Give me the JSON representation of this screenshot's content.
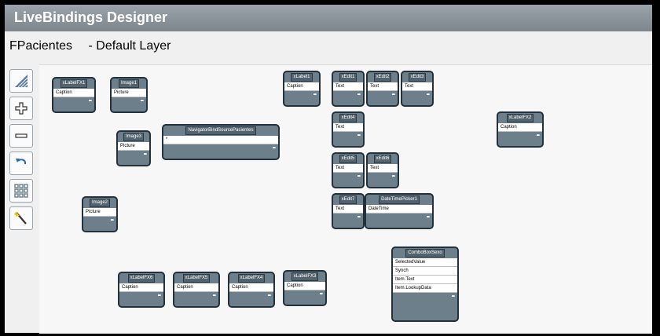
{
  "window": {
    "title": "LiveBindings Designer"
  },
  "toolbar": {
    "form_name": "FPacientes",
    "layer_label": "- Default Layer"
  },
  "tools": [
    {
      "name": "tool-layer-icon"
    },
    {
      "name": "zoom-in-icon"
    },
    {
      "name": "zoom-out-icon"
    },
    {
      "name": "undo-icon"
    },
    {
      "name": "grid-icon"
    },
    {
      "name": "wizard-icon"
    }
  ],
  "nodes": [
    {
      "title": "xLabelFX1",
      "fields": [
        "Caption"
      ],
      "ellipsis": "•••",
      "name": "node-xlabelfx1"
    },
    {
      "title": "Image1",
      "fields": [
        "Picture"
      ],
      "ellipsis": "•••",
      "name": "node-image1"
    },
    {
      "title": "xLabel1",
      "fields": [
        "Caption"
      ],
      "ellipsis": "•••",
      "name": "node-xlabel1"
    },
    {
      "title": "xEdit1",
      "fields": [
        "Text"
      ],
      "ellipsis": "•••",
      "name": "node-xedit1"
    },
    {
      "title": "xEdit2",
      "fields": [
        "Text"
      ],
      "ellipsis": "•••",
      "name": "node-xedit2"
    },
    {
      "title": "xEdit3",
      "fields": [
        "Text"
      ],
      "ellipsis": "•••",
      "name": "node-xedit3"
    },
    {
      "title": "xEdit4",
      "fields": [
        "Text"
      ],
      "ellipsis": "•••",
      "name": "node-xedit4"
    },
    {
      "title": "xLabelFX2",
      "fields": [
        "Caption"
      ],
      "ellipsis": "•••",
      "name": "node-xlabelfx2"
    },
    {
      "title": "Image3",
      "fields": [
        "Picture"
      ],
      "ellipsis": "•••",
      "name": "node-image3"
    },
    {
      "title": "NavigatorBindSourcePacientes",
      "fields": [
        "*"
      ],
      "ellipsis": "•••",
      "name": "node-navigator"
    },
    {
      "title": "xEdit5",
      "fields": [
        "Text"
      ],
      "ellipsis": "•••",
      "name": "node-xedit5"
    },
    {
      "title": "xEdit6",
      "fields": [
        "Text"
      ],
      "ellipsis": "•••",
      "name": "node-xedit6"
    },
    {
      "title": "xEdit7",
      "fields": [
        "Text"
      ],
      "ellipsis": "•••",
      "name": "node-xedit7"
    },
    {
      "title": "DateTimePicker1",
      "fields": [
        "DateTime"
      ],
      "ellipsis": "•••",
      "name": "node-datetimepicker1"
    },
    {
      "title": "Image2",
      "fields": [
        "Picture"
      ],
      "ellipsis": "•••",
      "name": "node-image2"
    },
    {
      "title": "ComboBoxSexo",
      "fields": [
        "SelectedValue",
        "Synch",
        "Item.Text",
        "Item.LookupData"
      ],
      "ellipsis": "•••",
      "name": "node-comboboxsexo"
    },
    {
      "title": "xLabelFX6",
      "fields": [
        "Caption"
      ],
      "ellipsis": "•••",
      "name": "node-xlabelfx6"
    },
    {
      "title": "xLabelFX5",
      "fields": [
        "Caption"
      ],
      "ellipsis": "•••",
      "name": "node-xlabelfx5"
    },
    {
      "title": "xLabelFX4",
      "fields": [
        "Caption"
      ],
      "ellipsis": "•••",
      "name": "node-xlabelfx4"
    },
    {
      "title": "xLabelFX3",
      "fields": [
        "Caption"
      ],
      "ellipsis": "•••",
      "name": "node-xlabelfx3"
    }
  ]
}
